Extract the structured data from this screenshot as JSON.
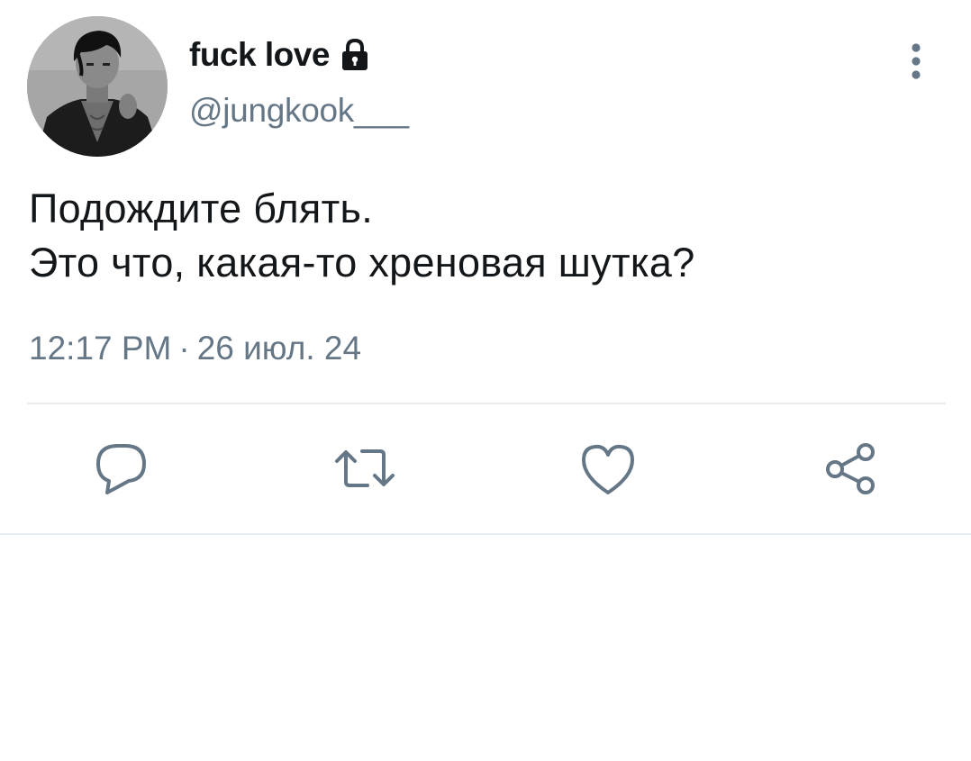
{
  "tweet": {
    "author": {
      "display_name": "fuck love",
      "handle": "@jungkook___",
      "protected_icon": "lock-icon",
      "avatar_icon": "profile-photo"
    },
    "text_lines": [
      "Подождите блять.",
      "Это что, какая-то хреновая шутка?"
    ],
    "time": "12:17 PM",
    "separator": "·",
    "date": "26 июл. 24",
    "menu_icon": "more-vertical-icon",
    "actions": [
      {
        "name": "reply",
        "icon": "reply-icon"
      },
      {
        "name": "retweet",
        "icon": "retweet-icon"
      },
      {
        "name": "like",
        "icon": "heart-icon"
      },
      {
        "name": "share",
        "icon": "share-icon"
      }
    ]
  },
  "colors": {
    "primary_text": "#14171a",
    "secondary_text": "#657786",
    "icon": "#657786",
    "divider": "#e6ecf0",
    "background": "#ffffff"
  }
}
